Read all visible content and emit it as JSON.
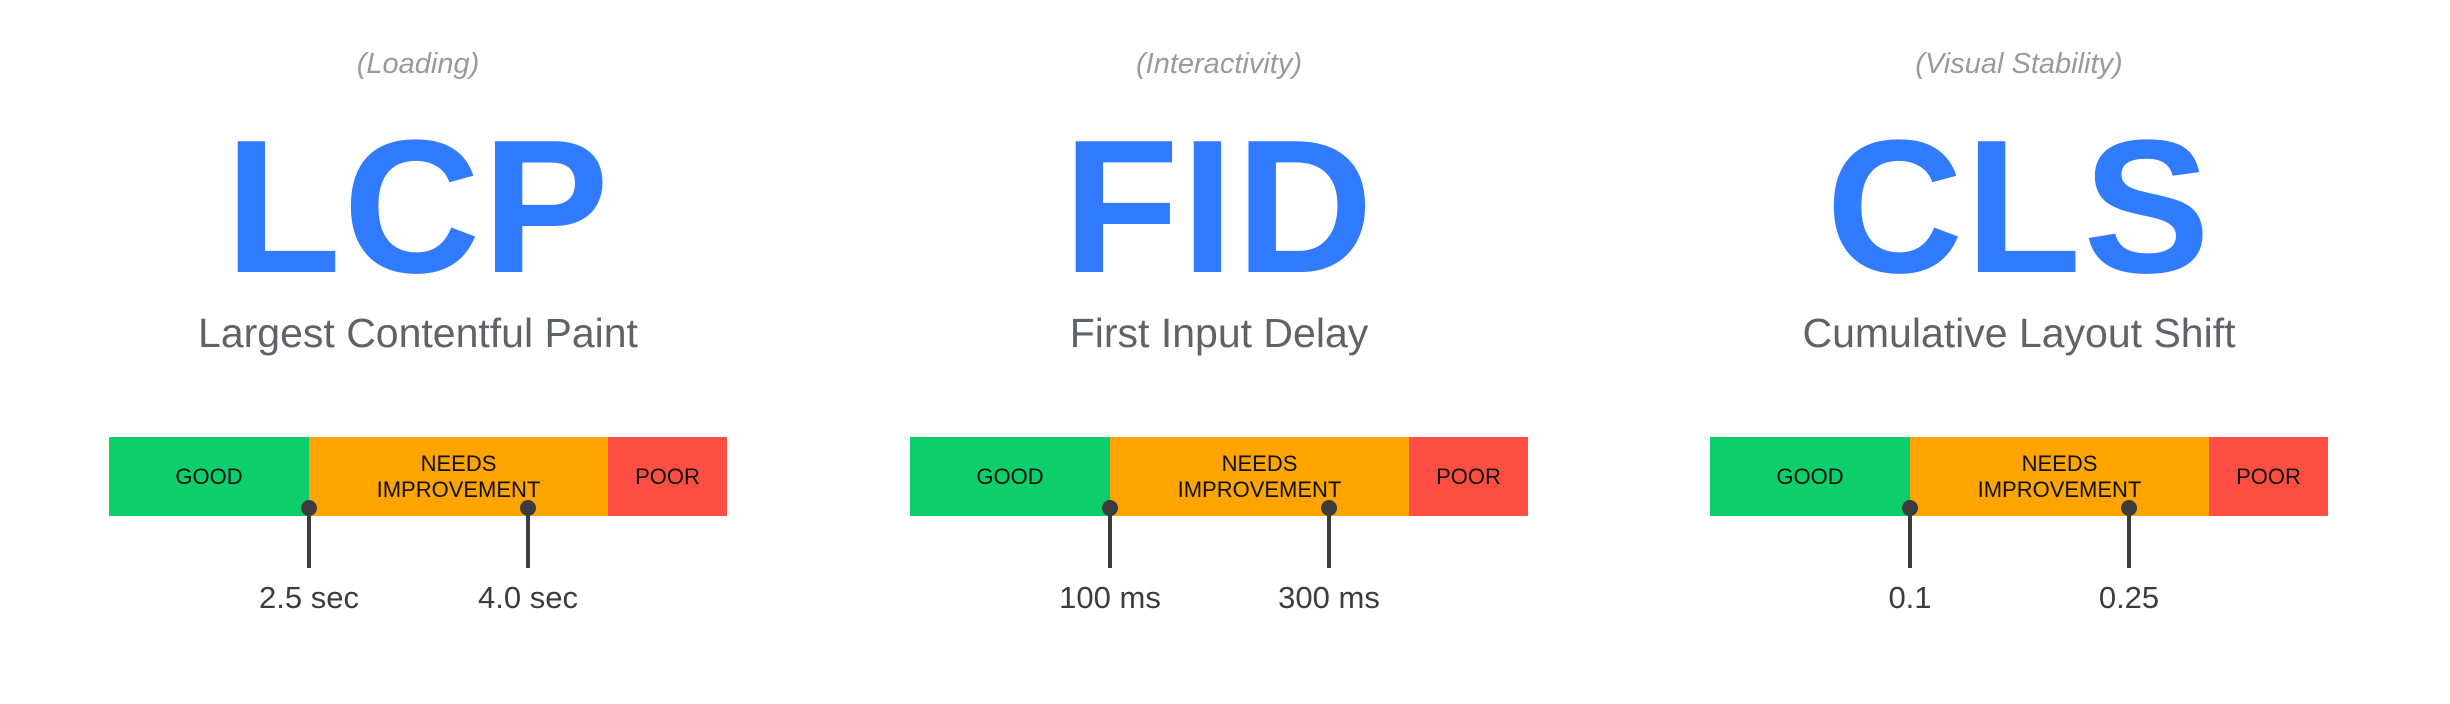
{
  "colors": {
    "good": "#0ccf6b",
    "needs_improvement": "#ffa400",
    "poor": "#ff4e42",
    "metric": "#307bff"
  },
  "metrics": [
    {
      "category": "(Loading)",
      "abbr": "LCP",
      "name": "Largest Contentful Paint",
      "good": "GOOD",
      "needs": "NEEDS IMPROVEMENT",
      "poor": "POOR",
      "thresholds": [
        "2.5 sec",
        "4.0 sec"
      ]
    },
    {
      "category": "(Interactivity)",
      "abbr": "FID",
      "name": "First Input Delay",
      "good": "GOOD",
      "needs": "NEEDS IMPROVEMENT",
      "poor": "POOR",
      "thresholds": [
        "100 ms",
        "300 ms"
      ]
    },
    {
      "category": "(Visual Stability)",
      "abbr": "CLS",
      "name": "Cumulative Layout Shift",
      "good": "GOOD",
      "needs": "NEEDS IMPROVEMENT",
      "poor": "POOR",
      "thresholds": [
        "0.1",
        "0.25"
      ]
    }
  ]
}
